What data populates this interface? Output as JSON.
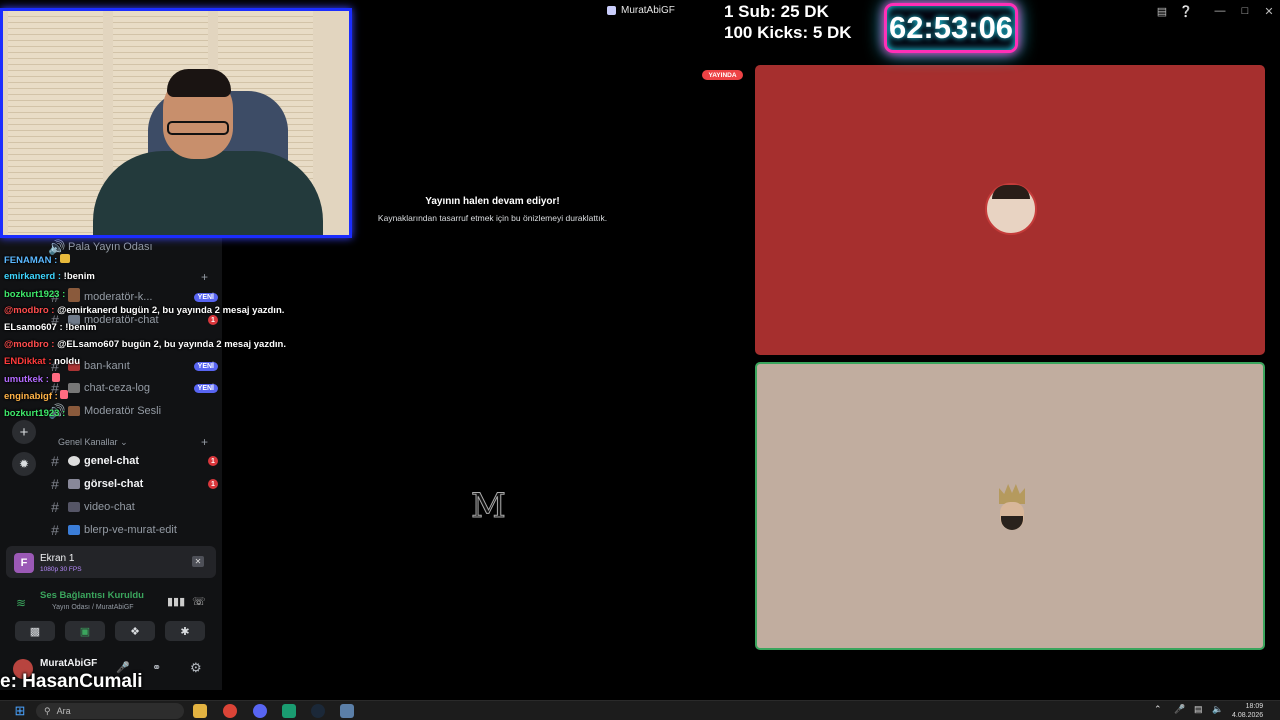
{
  "window": {
    "title": "MuratAbiGF",
    "controls": [
      "minimize-icon",
      "maximize-icon",
      "close-icon"
    ]
  },
  "overlay": {
    "sub_line": "1 Sub: 25 DK",
    "kick_line": "100 Kicks: 5 DK",
    "timer": "62:53:06",
    "chat_messages": [
      {
        "user": "FENAMAN :",
        "text": "",
        "color": "#5bb8ff"
      },
      {
        "user": "emirkanerd :",
        "text": "!benim",
        "color": "#3ed6ff"
      },
      {
        "user": "bozkurt1923 :",
        "text": "",
        "color": "#3ee86a"
      },
      {
        "user": "@modbro :",
        "text": "@emirkanerd bugün 2, bu yayında 2 mesaj yazdın.",
        "color": "#ff4d4d"
      },
      {
        "user": "ELsamo607 :",
        "text": "!benim",
        "color": "#ffffff"
      },
      {
        "user": "@modbro :",
        "text": "@ELsamo607 bugün 2, bu yayında 2 mesaj yazdın.",
        "color": "#ff4d4d"
      },
      {
        "user": "ENDikkat :",
        "text": "noldu",
        "color": "#ff3b3b"
      },
      {
        "user": "umutkek :",
        "text": "",
        "color": "#b36bff"
      },
      {
        "user": "enginabigf :",
        "text": "",
        "color": "#ffb347"
      },
      {
        "user": "bozkurt1923 :",
        "text": "",
        "color": "#3ee86a"
      }
    ],
    "bottom_name": "e: HasanCumali"
  },
  "sidebar": {
    "channels_top": [
      {
        "label": "Pala Yayın Odası",
        "type": "voice"
      },
      {
        "label": "moderatör-k...",
        "badge": "YENİ"
      },
      {
        "label": "moderatör-chat",
        "badge_count": "1"
      },
      {
        "label": "ban-kanıt",
        "badge": "YENİ"
      },
      {
        "label": "chat-ceza-log",
        "badge": "YENİ"
      },
      {
        "label": "Moderatör Sesli",
        "type": "voice"
      }
    ],
    "category": "Genel Kanallar",
    "channels": [
      {
        "label": "genel-chat",
        "badge_count": "1",
        "unread": true
      },
      {
        "label": "görsel-chat",
        "badge_count": "1",
        "unread": true
      },
      {
        "label": "video-chat",
        "unread": false
      },
      {
        "label": "blerp-ve-murat-edit",
        "unread": false
      }
    ],
    "stream_panel": {
      "name": "Ekran 1",
      "quality": "1080p 30 FPS",
      "avatar_letter": "F"
    },
    "voice_panel": {
      "status": "Ses Bağlantısı Kuruldu",
      "channel": "Yayın Odası / MuratAbiGF"
    },
    "user_panel": {
      "username": "MuratAbiGF",
      "status": "Ekranı..."
    }
  },
  "main": {
    "live_badge": "YAYINDA",
    "paused_title": "Yayının halen devam ediyor!",
    "paused_sub": "Kaynaklarından tasarruf etmek için bu önizlemeyi duraklattık.",
    "logo_letter": "M"
  },
  "taskbar": {
    "search_placeholder": "Ara",
    "time": "18:09",
    "date": "4.08.2026"
  },
  "colors": {
    "accent": "#5865f2",
    "live_red": "#ed4245",
    "voice_green": "#3ba55d",
    "tile_red": "#a62f2e",
    "tile_beige": "#c1ad9f",
    "timer_pink": "#ff2fb7",
    "timer_cyan": "#21e6ff"
  }
}
